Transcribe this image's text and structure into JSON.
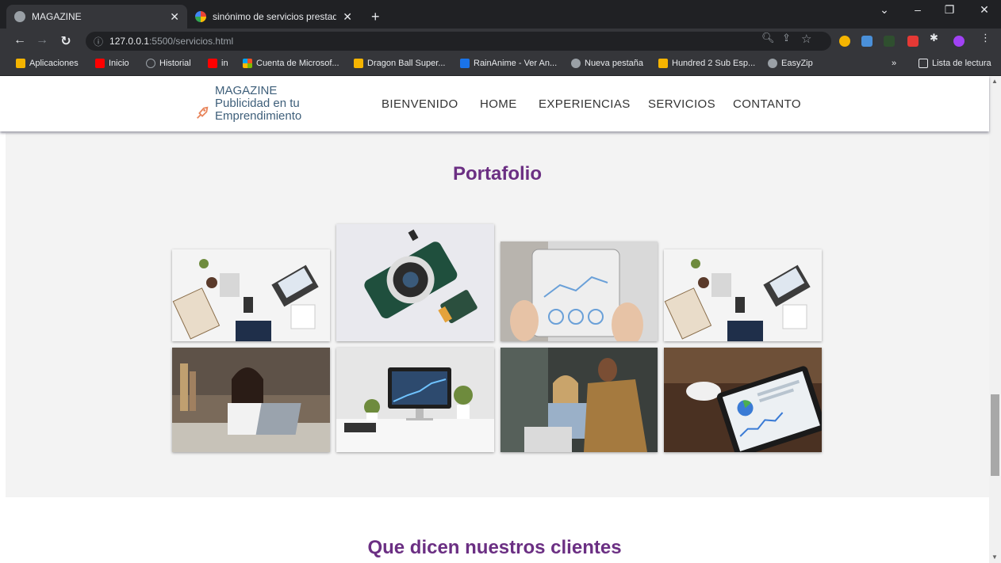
{
  "browser": {
    "tabs": [
      {
        "title": "MAGAZINE",
        "active": true,
        "icon": "globe-icon"
      },
      {
        "title": "sinónimo de servicios prestados",
        "active": false,
        "icon": "google-icon"
      }
    ],
    "new_tab": "+",
    "url_host": "127.0.0.1",
    "url_rest": ":5500/servicios.html",
    "bookmarks": [
      {
        "label": "Aplicaciones",
        "icon": "apps-grid-icon",
        "color": "#f4b400"
      },
      {
        "label": "Inicio",
        "icon": "youtube-icon",
        "color": "#ff0000"
      },
      {
        "label": "Historial",
        "icon": "history-icon",
        "color": "#9aa0a6"
      },
      {
        "label": "in",
        "icon": "youtube-icon",
        "color": "#ff0000"
      },
      {
        "label": "Cuenta de Microsof...",
        "icon": "microsoft-icon",
        "color": "#f25022"
      },
      {
        "label": "Dragon Ball Super...",
        "icon": "bookmark-star-icon",
        "color": "#f6b400"
      },
      {
        "label": "RainAnime - Ver An...",
        "icon": "ra-icon",
        "color": "#1a73e8"
      },
      {
        "label": "Nueva pestaña",
        "icon": "globe-icon",
        "color": "#9aa0a6"
      },
      {
        "label": "Hundred 2 Sub Esp...",
        "icon": "bookmark-star-icon",
        "color": "#f6b400"
      },
      {
        "label": "EasyZip",
        "icon": "globe-icon",
        "color": "#9aa0a6"
      }
    ],
    "reading_list": "Lista de lectura",
    "more_bookmarks": "»"
  },
  "site": {
    "logo_lines": [
      "MAGAZINE",
      "Publicidad en tu",
      "Emprendimiento"
    ],
    "nav": [
      "BIENVENIDO",
      "HOME",
      "EXPERIENCIAS",
      "SERVICIOS",
      "CONTANTO"
    ],
    "portfolio_title": "Portafolio",
    "clients_title": "Que dicen nuestros clientes",
    "accent_color": "#6b2f83"
  },
  "gallery": [
    {
      "name": "photo-desk-office",
      "subject": "desk with laptop and documents"
    },
    {
      "name": "photo-camera",
      "subject": "camera on white background"
    },
    {
      "name": "photo-tablet-charts",
      "subject": "hands holding tablet with charts"
    },
    {
      "name": "photo-desk-office-2",
      "subject": "desk with laptop and documents"
    },
    {
      "name": "photo-woman-laptop",
      "subject": "woman working on laptop"
    },
    {
      "name": "photo-imac-desk",
      "subject": "computer on white desk"
    },
    {
      "name": "photo-team-meeting",
      "subject": "colleagues reviewing laptop"
    },
    {
      "name": "photo-tablet-analytics",
      "subject": "tablet showing analytics"
    }
  ]
}
